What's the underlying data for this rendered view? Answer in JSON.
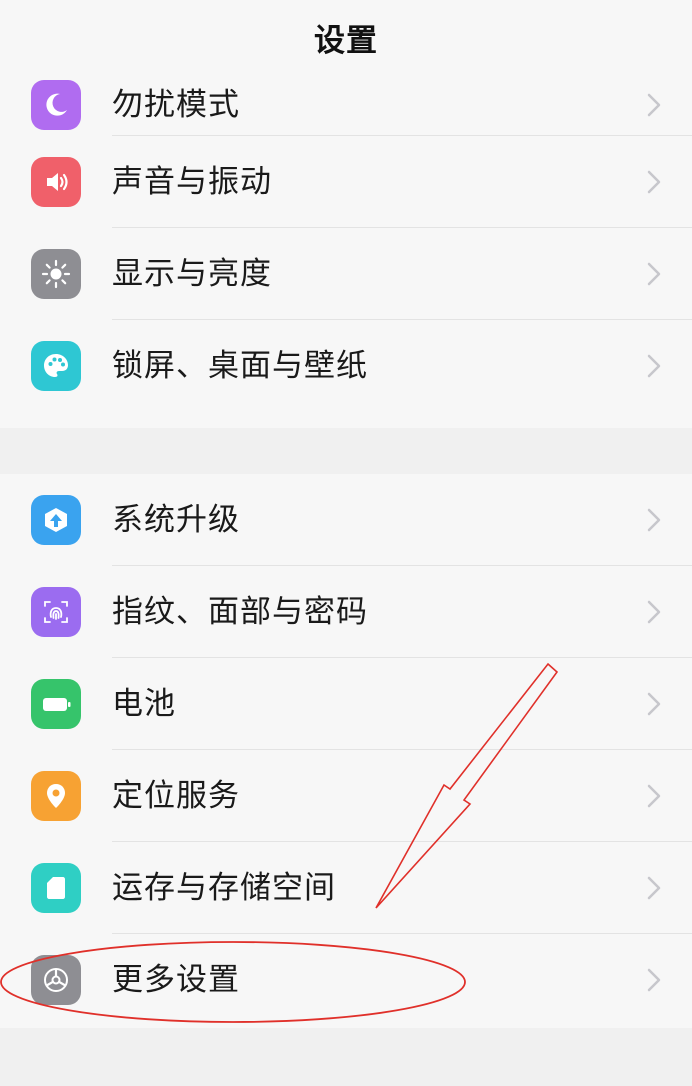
{
  "header": {
    "title": "设置"
  },
  "groups": [
    {
      "items": [
        {
          "label": "勿扰模式",
          "icon": "moon-icon",
          "color": "#b06cf0"
        },
        {
          "label": "声音与振动",
          "icon": "speaker-icon",
          "color": "#f0606a"
        },
        {
          "label": "显示与亮度",
          "icon": "sun-icon",
          "color": "#8e8e93"
        },
        {
          "label": "锁屏、桌面与壁纸",
          "icon": "palette-icon",
          "color": "#2ec7d3"
        }
      ]
    },
    {
      "items": [
        {
          "label": "系统升级",
          "icon": "upgrade-icon",
          "color": "#3aa3ef"
        },
        {
          "label": "指纹、面部与密码",
          "icon": "fingerprint-icon",
          "color": "#9b6cf0"
        },
        {
          "label": "电池",
          "icon": "battery-icon",
          "color": "#36c46b"
        },
        {
          "label": "定位服务",
          "icon": "location-pin-icon",
          "color": "#f7a233"
        },
        {
          "label": "运存与存储空间",
          "icon": "sd-card-icon",
          "color": "#2fcfc4"
        },
        {
          "label": "更多设置",
          "icon": "gear-icon",
          "color": "#8e8e93"
        }
      ]
    }
  ],
  "annotation": {
    "color": "#e0302a"
  }
}
